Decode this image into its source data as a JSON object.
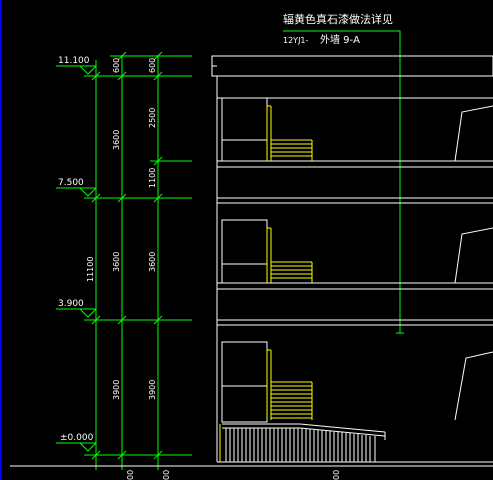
{
  "note": {
    "title": "辐黄色真石漆做法详见",
    "ref_code": "12YJ1-",
    "ref_item": "外墙 9-A"
  },
  "levels": [
    "11.100",
    "7.500",
    "3.900",
    "±0.000"
  ],
  "dimensions": {
    "col1": [
      "600",
      "3600",
      "3600",
      "3900"
    ],
    "col2": [
      "600",
      "2500",
      "1100",
      "3600",
      "3900"
    ],
    "total": "11100",
    "bottom": [
      "00",
      "00",
      "00"
    ]
  },
  "colors": {
    "background": "#000000",
    "dimension_lines": "#00ff00",
    "building_lines": "#ffffff",
    "railing": "#ffff00",
    "leader": "#00ff00",
    "left_edge": "#0000ff"
  }
}
